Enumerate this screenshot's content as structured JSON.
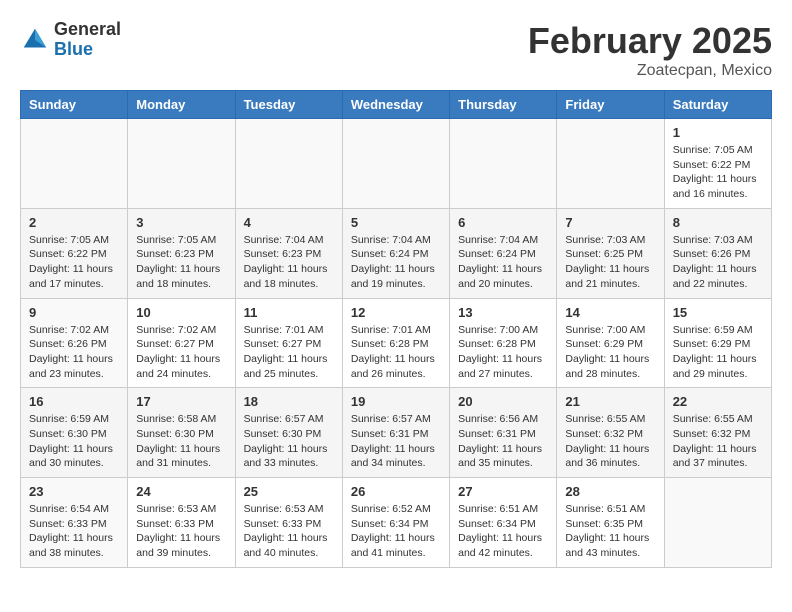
{
  "logo": {
    "general": "General",
    "blue": "Blue"
  },
  "header": {
    "month": "February 2025",
    "location": "Zoatecpan, Mexico"
  },
  "weekdays": [
    "Sunday",
    "Monday",
    "Tuesday",
    "Wednesday",
    "Thursday",
    "Friday",
    "Saturday"
  ],
  "weeks": [
    [
      {
        "day": "",
        "info": ""
      },
      {
        "day": "",
        "info": ""
      },
      {
        "day": "",
        "info": ""
      },
      {
        "day": "",
        "info": ""
      },
      {
        "day": "",
        "info": ""
      },
      {
        "day": "",
        "info": ""
      },
      {
        "day": "1",
        "info": "Sunrise: 7:05 AM\nSunset: 6:22 PM\nDaylight: 11 hours and 16 minutes."
      }
    ],
    [
      {
        "day": "2",
        "info": "Sunrise: 7:05 AM\nSunset: 6:22 PM\nDaylight: 11 hours and 17 minutes."
      },
      {
        "day": "3",
        "info": "Sunrise: 7:05 AM\nSunset: 6:23 PM\nDaylight: 11 hours and 18 minutes."
      },
      {
        "day": "4",
        "info": "Sunrise: 7:04 AM\nSunset: 6:23 PM\nDaylight: 11 hours and 18 minutes."
      },
      {
        "day": "5",
        "info": "Sunrise: 7:04 AM\nSunset: 6:24 PM\nDaylight: 11 hours and 19 minutes."
      },
      {
        "day": "6",
        "info": "Sunrise: 7:04 AM\nSunset: 6:24 PM\nDaylight: 11 hours and 20 minutes."
      },
      {
        "day": "7",
        "info": "Sunrise: 7:03 AM\nSunset: 6:25 PM\nDaylight: 11 hours and 21 minutes."
      },
      {
        "day": "8",
        "info": "Sunrise: 7:03 AM\nSunset: 6:26 PM\nDaylight: 11 hours and 22 minutes."
      }
    ],
    [
      {
        "day": "9",
        "info": "Sunrise: 7:02 AM\nSunset: 6:26 PM\nDaylight: 11 hours and 23 minutes."
      },
      {
        "day": "10",
        "info": "Sunrise: 7:02 AM\nSunset: 6:27 PM\nDaylight: 11 hours and 24 minutes."
      },
      {
        "day": "11",
        "info": "Sunrise: 7:01 AM\nSunset: 6:27 PM\nDaylight: 11 hours and 25 minutes."
      },
      {
        "day": "12",
        "info": "Sunrise: 7:01 AM\nSunset: 6:28 PM\nDaylight: 11 hours and 26 minutes."
      },
      {
        "day": "13",
        "info": "Sunrise: 7:00 AM\nSunset: 6:28 PM\nDaylight: 11 hours and 27 minutes."
      },
      {
        "day": "14",
        "info": "Sunrise: 7:00 AM\nSunset: 6:29 PM\nDaylight: 11 hours and 28 minutes."
      },
      {
        "day": "15",
        "info": "Sunrise: 6:59 AM\nSunset: 6:29 PM\nDaylight: 11 hours and 29 minutes."
      }
    ],
    [
      {
        "day": "16",
        "info": "Sunrise: 6:59 AM\nSunset: 6:30 PM\nDaylight: 11 hours and 30 minutes."
      },
      {
        "day": "17",
        "info": "Sunrise: 6:58 AM\nSunset: 6:30 PM\nDaylight: 11 hours and 31 minutes."
      },
      {
        "day": "18",
        "info": "Sunrise: 6:57 AM\nSunset: 6:30 PM\nDaylight: 11 hours and 33 minutes."
      },
      {
        "day": "19",
        "info": "Sunrise: 6:57 AM\nSunset: 6:31 PM\nDaylight: 11 hours and 34 minutes."
      },
      {
        "day": "20",
        "info": "Sunrise: 6:56 AM\nSunset: 6:31 PM\nDaylight: 11 hours and 35 minutes."
      },
      {
        "day": "21",
        "info": "Sunrise: 6:55 AM\nSunset: 6:32 PM\nDaylight: 11 hours and 36 minutes."
      },
      {
        "day": "22",
        "info": "Sunrise: 6:55 AM\nSunset: 6:32 PM\nDaylight: 11 hours and 37 minutes."
      }
    ],
    [
      {
        "day": "23",
        "info": "Sunrise: 6:54 AM\nSunset: 6:33 PM\nDaylight: 11 hours and 38 minutes."
      },
      {
        "day": "24",
        "info": "Sunrise: 6:53 AM\nSunset: 6:33 PM\nDaylight: 11 hours and 39 minutes."
      },
      {
        "day": "25",
        "info": "Sunrise: 6:53 AM\nSunset: 6:33 PM\nDaylight: 11 hours and 40 minutes."
      },
      {
        "day": "26",
        "info": "Sunrise: 6:52 AM\nSunset: 6:34 PM\nDaylight: 11 hours and 41 minutes."
      },
      {
        "day": "27",
        "info": "Sunrise: 6:51 AM\nSunset: 6:34 PM\nDaylight: 11 hours and 42 minutes."
      },
      {
        "day": "28",
        "info": "Sunrise: 6:51 AM\nSunset: 6:35 PM\nDaylight: 11 hours and 43 minutes."
      },
      {
        "day": "",
        "info": ""
      }
    ]
  ]
}
